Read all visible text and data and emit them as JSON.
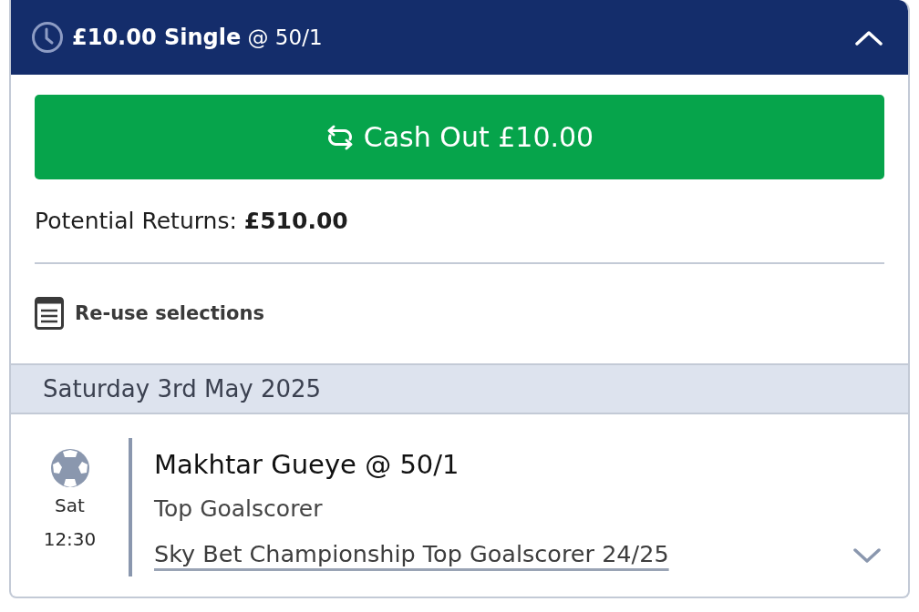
{
  "bet_header": {
    "title": "**£10.00 Single** @ 50/1",
    "expanded": true
  },
  "cash_out_button": {
    "label": "Cash Out £10.00"
  },
  "potential_returns": "Potential Returns: **£510.00**",
  "reuse_link": {
    "label": "Re-use selections"
  },
  "date_header": "Saturday 3rd May 2025",
  "selections": [
    {
      "day": "Sat",
      "time": "12:30",
      "title": "Makhtar Gueye @ 50/1",
      "market": "Top Goalscorer",
      "event": "Sky Bet Championship Top Goalscorer 24/25",
      "expanded": false
    }
  ]
}
